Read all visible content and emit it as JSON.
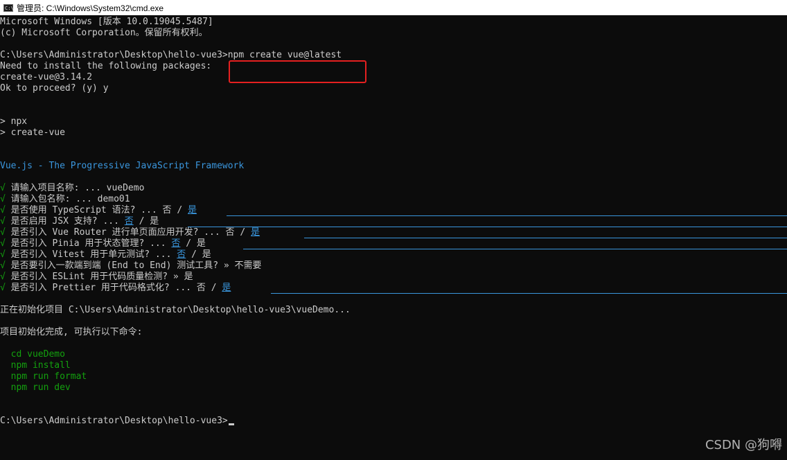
{
  "window": {
    "icon_text": "C:\\",
    "title": "管理员: C:\\Windows\\System32\\cmd.exe"
  },
  "terminal": {
    "banner1": "Microsoft Windows [版本 10.0.19045.5487]",
    "banner2": "(c) Microsoft Corporation。保留所有权利。",
    "prompt1": "C:\\Users\\Administrator\\Desktop\\hello-vue3>",
    "command1": "npm create vue@latest",
    "need_install": "Need to install the following packages:",
    "package": "create-vue@3.14.2",
    "proceed": "Ok to proceed? (y) y",
    "npx": "> npx",
    "create_vue": "> create-vue",
    "vue_banner": "Vue.js - The Progressive JavaScript Framework",
    "check_mark": "√",
    "q_project": {
      "label": "请输入项目名称: ... ",
      "answer": "vueDemo"
    },
    "q_package": {
      "label": "请输入包名称: ... ",
      "answer": "demo01"
    },
    "q_ts": {
      "label": "是否使用 TypeScript 语法? ... ",
      "no": "否",
      "sep": " / ",
      "yes": "是"
    },
    "q_jsx": {
      "label": "是否启用 JSX 支持? ... ",
      "no": "否",
      "sep": " / ",
      "yes": "是"
    },
    "q_router": {
      "label": "是否引入 Vue Router 进行单页面应用开发? ... ",
      "no": "否",
      "sep": " / ",
      "yes": "是"
    },
    "q_pinia": {
      "label": "是否引入 Pinia 用于状态管理? ... ",
      "no": "否",
      "sep": " / ",
      "yes": "是"
    },
    "q_vitest": {
      "label": "是否引入 Vitest 用于单元测试? ... ",
      "no": "否",
      "sep": " / ",
      "yes": "是"
    },
    "q_e2e": {
      "label": "是否要引入一款端到端 (End to End) 测试工具? » ",
      "answer": "不需要"
    },
    "q_eslint": {
      "label": "是否引入 ESLint 用于代码质量检测? » ",
      "answer": "是"
    },
    "q_prettier": {
      "label": "是否引入 Prettier 用于代码格式化? ... ",
      "no": "否",
      "sep": " / ",
      "yes": "是"
    },
    "init_msg": "正在初始化项目 C:\\Users\\Administrator\\Desktop\\hello-vue3\\vueDemo...",
    "done_msg": "项目初始化完成, 可执行以下命令:",
    "cmd_cd": "  cd vueDemo",
    "cmd_install": "  npm install",
    "cmd_format": "  npm run format",
    "cmd_dev": "  npm run dev",
    "prompt2": "C:\\Users\\Administrator\\Desktop\\hello-vue3>"
  },
  "watermark": "CSDN @狗嘚"
}
